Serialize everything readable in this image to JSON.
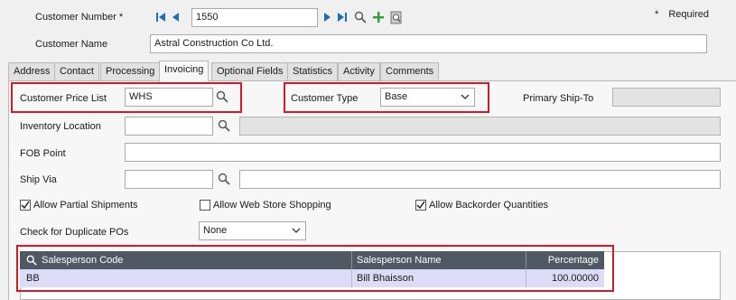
{
  "header": {
    "customer_number_label": "Customer Number *",
    "customer_number_value": "1550",
    "required_marker": "*",
    "required_label": "Required",
    "customer_name_label": "Customer Name",
    "customer_name_value": "Astral Construction Co Ltd."
  },
  "tabs": [
    {
      "label": "Address"
    },
    {
      "label": "Contact"
    },
    {
      "label": "Processing"
    },
    {
      "label": "Invoicing",
      "active": true
    },
    {
      "label": "Optional Fields"
    },
    {
      "label": "Statistics"
    },
    {
      "label": "Activity"
    },
    {
      "label": "Comments"
    }
  ],
  "invoicing": {
    "customer_price_list_label": "Customer Price List",
    "customer_price_list_value": "WHS",
    "customer_type_label": "Customer Type",
    "customer_type_value": "Base",
    "primary_ship_to_label": "Primary Ship-To",
    "primary_ship_to_value": "",
    "inventory_location_label": "Inventory Location",
    "inventory_location_value": "",
    "fob_point_label": "FOB Point",
    "fob_point_value": "",
    "ship_via_label": "Ship Via",
    "ship_via_value": "",
    "allow_partial_shipments_label": "Allow Partial Shipments",
    "allow_partial_shipments": true,
    "allow_web_store_label": "Allow Web Store Shopping",
    "allow_web_store": false,
    "allow_backorder_label": "Allow Backorder Quantities",
    "allow_backorder": true,
    "check_duplicate_pos_label": "Check for Duplicate POs",
    "check_duplicate_pos_value": "None"
  },
  "salesperson_grid": {
    "columns": [
      "Salesperson Code",
      "Salesperson Name",
      "Percentage"
    ],
    "rows": [
      {
        "code": "BB",
        "name": "Bill Bhaisson",
        "percentage": "100.00000"
      }
    ]
  },
  "colors": {
    "highlight_border": "#d11a2a",
    "grid_header": "#4f5863",
    "selected_row": "#dcdcf6",
    "add_icon": "#2e9e3a",
    "nav_icon": "#1f6fb2"
  }
}
